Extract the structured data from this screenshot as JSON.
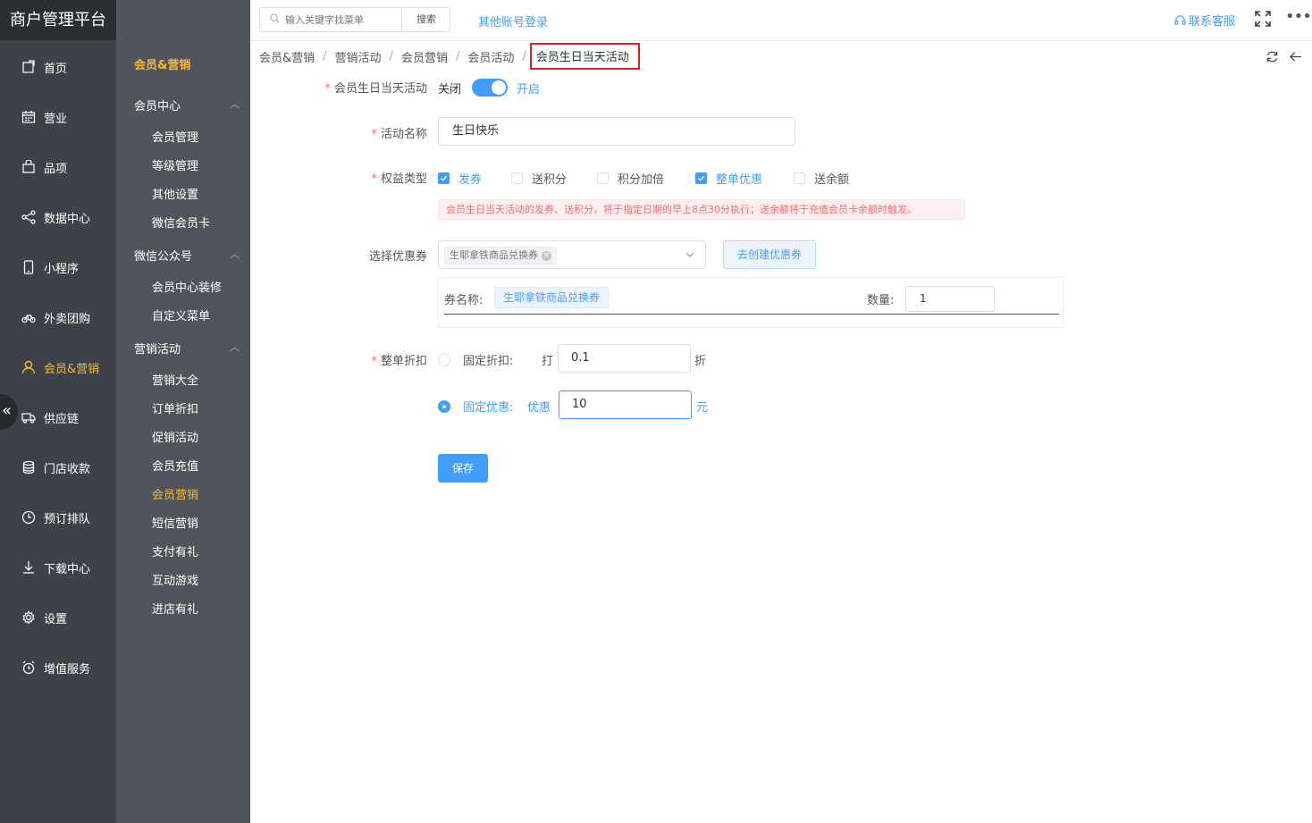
{
  "app": {
    "title": "商户管理平台"
  },
  "nav": {
    "items": [
      {
        "label": "首页",
        "icon": "home-icon"
      },
      {
        "label": "营业",
        "icon": "calendar-icon"
      },
      {
        "label": "品项",
        "icon": "bag-icon"
      },
      {
        "label": "数据中心",
        "icon": "share-icon"
      },
      {
        "label": "小程序",
        "icon": "phone-icon"
      },
      {
        "label": "外卖团购",
        "icon": "bike-icon"
      },
      {
        "label": "会员&营销",
        "icon": "user-icon"
      },
      {
        "label": "供应链",
        "icon": "truck-icon"
      },
      {
        "label": "门店收款",
        "icon": "coins-icon"
      },
      {
        "label": "预订排队",
        "icon": "clock-icon"
      },
      {
        "label": "下载中心",
        "icon": "download-icon"
      },
      {
        "label": "设置",
        "icon": "gear-icon"
      },
      {
        "label": "增值服务",
        "icon": "alarm-icon"
      }
    ],
    "active_index": 6,
    "collapse_glyph": "«"
  },
  "subnav": {
    "title": "会员&营销",
    "groups": [
      {
        "label": "会员中心",
        "items": [
          "会员管理",
          "等级管理",
          "其他设置",
          "微信会员卡"
        ]
      },
      {
        "label": "微信公众号",
        "items": [
          "会员中心装修",
          "自定义菜单"
        ]
      },
      {
        "label": "营销活动",
        "items": [
          "营销大全",
          "订单折扣",
          "促销活动",
          "会员充值",
          "会员营销",
          "短信营销",
          "支付有礼",
          "互动游戏",
          "进店有礼"
        ]
      }
    ],
    "active_item": "会员营销"
  },
  "topbar": {
    "search_placeholder": "输入关键字找菜单",
    "search_button": "搜索",
    "other_login": "其他账号登录",
    "contact": "联系客服"
  },
  "breadcrumb": [
    "会员&营销",
    "营销活动",
    "会员营销",
    "会员活动",
    "会员生日当天活动"
  ],
  "form": {
    "activity_toggle": {
      "label": "会员生日当天活动",
      "off_text": "关闭",
      "on_text": "开启",
      "enabled": true
    },
    "name": {
      "label": "活动名称",
      "value": "生日快乐"
    },
    "benefit": {
      "label": "权益类型",
      "options": [
        {
          "label": "发券",
          "checked": true
        },
        {
          "label": "送积分",
          "checked": false
        },
        {
          "label": "积分加倍",
          "checked": false
        },
        {
          "label": "整单优惠",
          "checked": true
        },
        {
          "label": "送余额",
          "checked": false
        }
      ],
      "notice": "会员生日当天活动的发券、送积分，将于指定日期的早上8点30分执行；送余额将于充值会员卡余额时触发。"
    },
    "coupon": {
      "label": "选择优惠券",
      "selected_tag": "生耶拿铁商品兑换券",
      "create_button": "去创建优惠券",
      "name_label": "券名称:",
      "name_value": "生耶拿铁商品兑换券",
      "qty_label": "数量:",
      "qty_value": "1"
    },
    "discount": {
      "label": "整单折扣",
      "fixed_rate": {
        "label": "固定折扣:",
        "prefix": "打",
        "value": "0.1",
        "suffix": "折",
        "selected": false
      },
      "fixed_amount": {
        "label": "固定优惠:",
        "prefix": "优惠",
        "value": "10",
        "suffix": "元",
        "selected": true
      }
    },
    "save_button": "保存"
  },
  "colors": {
    "primary": "#409eff",
    "nav_bg": "#3d4249",
    "subnav_bg": "#50555b",
    "active": "#f5b93a",
    "danger": "#f56c6c"
  }
}
